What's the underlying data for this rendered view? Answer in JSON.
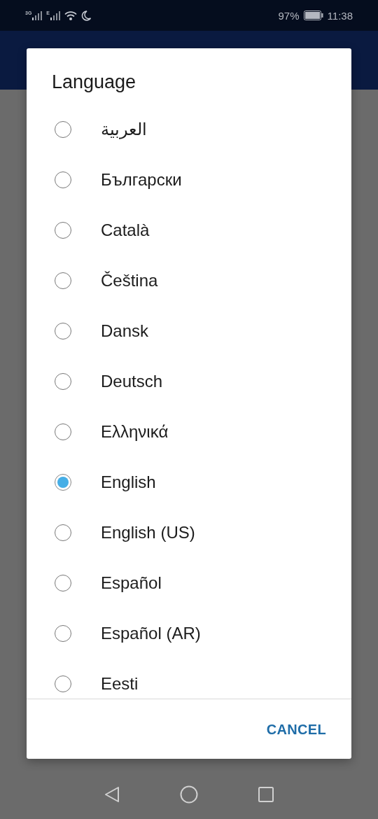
{
  "status_bar": {
    "network_1": "3G",
    "network_2": "E",
    "battery": "97%",
    "time": "11:38"
  },
  "dialog": {
    "title": "Language",
    "options": [
      {
        "label": "العربية",
        "selected": false
      },
      {
        "label": "Български",
        "selected": false
      },
      {
        "label": "Català",
        "selected": false
      },
      {
        "label": "Čeština",
        "selected": false
      },
      {
        "label": "Dansk",
        "selected": false
      },
      {
        "label": "Deutsch",
        "selected": false
      },
      {
        "label": "Ελληνικά",
        "selected": false
      },
      {
        "label": "English",
        "selected": true
      },
      {
        "label": "English (US)",
        "selected": false
      },
      {
        "label": "Español",
        "selected": false
      },
      {
        "label": "Español (AR)",
        "selected": false
      },
      {
        "label": "Eesti",
        "selected": false
      }
    ],
    "buttons": [
      "CANCEL"
    ]
  }
}
